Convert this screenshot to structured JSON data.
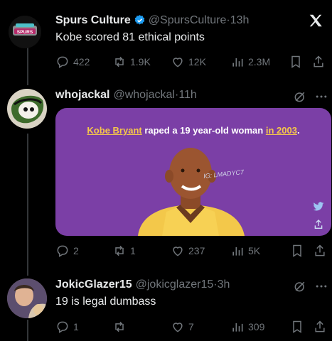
{
  "tweets": [
    {
      "name": "Spurs Culture",
      "verified": true,
      "handle": "@SpursCulture",
      "time": "13h",
      "text": "Kobe scored 81 ethical points",
      "avatar_text": "SPURS",
      "stats": {
        "replies": "422",
        "retweets": "1.9K",
        "likes": "12K",
        "views": "2.3M"
      }
    },
    {
      "name": "whojackal",
      "handle": "@whojackal",
      "time": "11h",
      "media": {
        "caption_pre": "Kobe Bryant",
        "caption_mid": " raped a 19 year-old woman ",
        "caption_post": "in 2003",
        "caption_end": ".",
        "watermark": "IG: LMADYC7"
      },
      "stats": {
        "replies": "2",
        "retweets": "1",
        "likes": "237",
        "views": "5K"
      }
    },
    {
      "name": "JokicGlazer15",
      "handle": "@jokicglazer15",
      "time": "3h",
      "text": "19 is legal dumbass",
      "stats": {
        "replies": "1",
        "retweets": "",
        "likes": "7",
        "views": "309"
      }
    }
  ],
  "colors": {
    "accent": "#1d9bf0",
    "muted": "#71767b",
    "background": "#000000"
  }
}
